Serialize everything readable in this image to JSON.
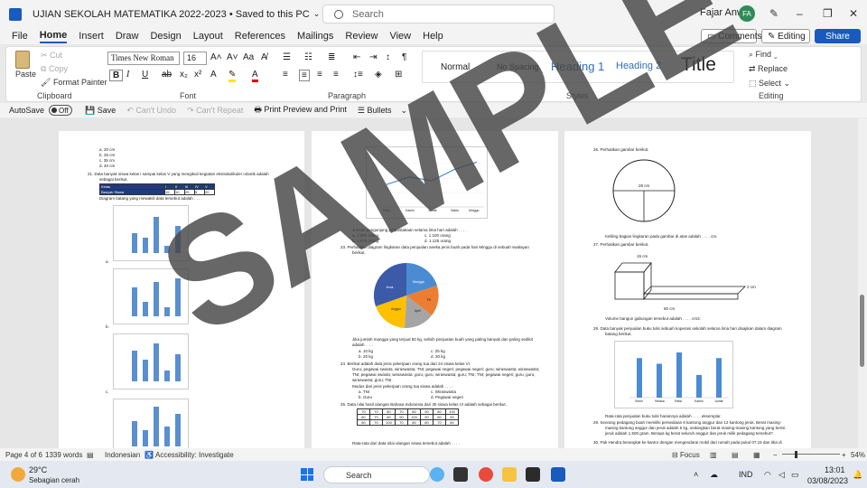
{
  "titlebar": {
    "doc_title": "UJIAN SEKOLAH MATEMATIKA 2022-2023 • Saved to this PC",
    "search_placeholder": "Search",
    "user_name": "Fajar Anwar",
    "avatar_initials": "FA"
  },
  "menu": [
    "File",
    "Home",
    "Insert",
    "Draw",
    "Design",
    "Layout",
    "References",
    "Mailings",
    "Review",
    "View",
    "Help"
  ],
  "menu_buttons": {
    "comments": "Comments",
    "editing": "Editing",
    "share": "Share"
  },
  "ribbon": {
    "clipboard": {
      "paste": "Paste",
      "cut": "Cut",
      "copy": "Copy",
      "format_painter": "Format Painter",
      "label": "Clipboard"
    },
    "font": {
      "name": "Times New Roman",
      "size": "16",
      "label": "Font"
    },
    "paragraph": {
      "label": "Paragraph"
    },
    "styles": {
      "items": [
        "Normal",
        "No Spacing",
        "Heading 1",
        "Heading 2",
        "Title"
      ],
      "label": "Styles"
    },
    "editing": {
      "find": "Find",
      "replace": "Replace",
      "select": "Select",
      "label": "Editing"
    }
  },
  "qat": {
    "autosave": "AutoSave",
    "autosave_state": "Off",
    "save": "Save",
    "undo": "Can't Undo",
    "repeat": "Can't Repeat",
    "print_preview": "Print Preview and Print",
    "bullets": "Bullets"
  },
  "pages": {
    "p1": {
      "lines": [
        "a.   20 cm",
        "b.   25 cm",
        "c.   35 cm",
        "d.   40 cm",
        "21.   Data banyak siswa kelas I sampai kelas V yang mengikuti kegiatan ekstrakulikuler robotik adalah",
        "sebagai berikut.",
        "Diagram batang yang mewakili data tersebut adalah . . . ."
      ],
      "table_head": [
        "Kelas",
        "I",
        "II",
        "III",
        "IV",
        "V"
      ],
      "table_row": [
        "Banyak Siswa",
        "15",
        "10",
        "25",
        "5",
        "20"
      ],
      "options": [
        "a.",
        "b.",
        "c."
      ]
    },
    "p2": {
      "lines": [
        "Jumlah pengunjung perpustakaan selama lima hari adalah . . . .",
        "a.   1.050 orang",
        "c.   1.100 orang",
        "b.   1.075 orang",
        "d.   1.125 orang",
        "23.   Perhatikan diagram lingkaran data penjualan aneka jenis buah pada hari Minggu di sebuah swalayan",
        "berikut.",
        "Jika jumlah mangga yang terjual 50 kg, selisih penjualan buah yang paling banyak dan paling sedikit",
        "adalah . . . .",
        "a.   10 kg",
        "c.   25 kg",
        "b.   20 kg",
        "d.   30 kg",
        "24.   Berikut adalah data jenis pekerjaan orang tua dari 24 siswa kelas VI.",
        "Guru; pegawai swasta; wiraswasta; TNI; pegawai negeri; pegawai negeri; guru; wiraswasta; wiraswasta;",
        "TNI; pegawai swasta; wiraswasta; guru; guru; wiraswasta; guru; TNI; TNI; pegawai negeri; guru; guru;",
        "wiraswasta; guru; TNI.",
        "Modus dari jenis pekerjaan orang tua siswa adalah . . . .",
        "a.   TNI",
        "c.  Wiraswasta",
        "b.   Guru",
        "d.  Pegawai negeri",
        "25.   Data nilai hasil ulangan Bahasa Indonesia dari 30 siswa kelas VI adalah sebagai berikut.",
        "Rata-rata dari data nilai ulangan siswa tersebut adalah . . . ."
      ],
      "line_labels": [
        "Rabu",
        "Kamis",
        "Jumat",
        "Sabtu",
        "Minggu"
      ],
      "pie_labels": [
        "Jeruk",
        "Mangga",
        "Apel",
        "Anggur",
        "Pir"
      ],
      "score_rows": [
        [
          "70",
          "70",
          "80",
          "70",
          "80",
          "90",
          "80",
          "100"
        ],
        [
          "80",
          "70",
          "80",
          "90",
          "100",
          "90",
          "80",
          "90"
        ],
        [
          "80",
          "70",
          "100",
          "70",
          "80",
          "80",
          "70",
          "80"
        ]
      ]
    },
    "p3": {
      "lines": [
        "26.   Perhatikan gambar berikut.",
        "Keliling bagian lingkaran pada gambar di atas adalah . . . . cm.",
        "27.   Perhatikan gambar berikut.",
        "Volume bangun gabungan tersebut adalah . . . . cm3.",
        "28.   Data banyak penjualan buku tulis sebuah koperasi sekolah selama lima hari disajikan dalam diagram",
        "batang berikut.",
        "Rata-rata penjualan buku tulis hariannya adalah . . . . eksemplar.",
        "29.   Seorang pedagang buah memiliki persediaan 6 kantong anggur dan 12 kantong jeruk. Berat masing-",
        "masing kantong anggur dan jeruk adalah 5 kg, sedangkan berat masing-masing kantong yang berisi",
        "jeruk adalah 1.500 gram. Berapa kg berat seluruh anggur dan jeruk milik pedagang tersebut?",
        "30.   Pak Hendra berangkat ke kantor dengan mengendarai mobil dari rumah pada pukul 07.15 dan tiba di"
      ],
      "circle_label": "28 cm",
      "box_top": "15 cm",
      "box_side": "2 cm",
      "box_bottom": "60 cm",
      "bar_labels": [
        "Senin",
        "Selasa",
        "Rabu",
        "Kamis",
        "Jumat"
      ]
    },
    "watermark": "SAMPLE"
  },
  "chart_data": [
    {
      "type": "bar",
      "categories": [
        "Senin",
        "Selasa",
        "Rabu",
        "Kamis",
        "Jumat"
      ],
      "values": [
        35,
        30,
        40,
        20,
        35
      ]
    },
    {
      "type": "line",
      "categories": [
        "Rabu",
        "Kamis",
        "Jumat",
        "Sabtu",
        "Minggu"
      ],
      "values": [
        150,
        200,
        175,
        250,
        300
      ],
      "ylim": [
        0,
        350
      ]
    }
  ],
  "status": {
    "page": "Page 4 of 6",
    "words": "1339 words",
    "language": "Indonesian",
    "accessibility": "Accessibility: Investigate",
    "focus": "Focus",
    "zoom": "54%"
  },
  "taskbar": {
    "temp": "29°C",
    "weather": "Sebagian cerah",
    "search": "Search",
    "lang": "IND",
    "time": "13:01",
    "date": "03/08/2023"
  }
}
